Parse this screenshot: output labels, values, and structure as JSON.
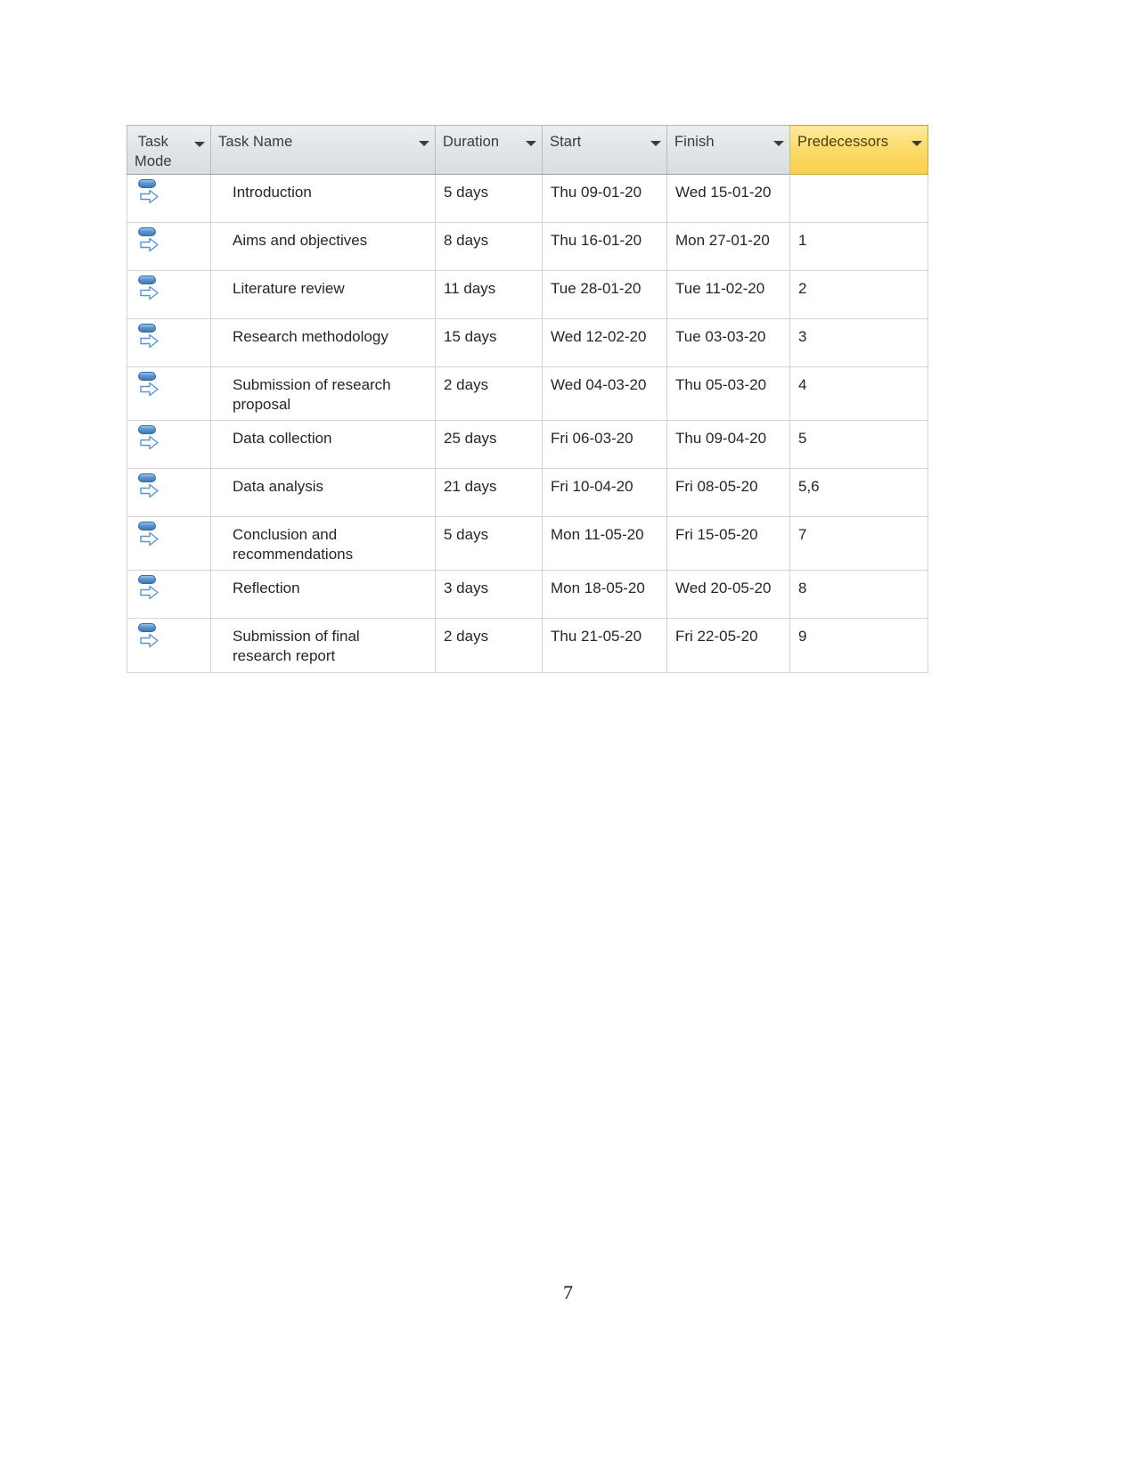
{
  "document": {
    "page_number": "7"
  },
  "table": {
    "columns": [
      {
        "key": "task_mode",
        "label": "Task\nMode",
        "filter_icon": "chevron-down-icon",
        "highlighted": false
      },
      {
        "key": "task_name",
        "label": "Task Name",
        "filter_icon": "chevron-down-icon",
        "highlighted": false
      },
      {
        "key": "duration",
        "label": "Duration",
        "filter_icon": "chevron-down-icon",
        "highlighted": false
      },
      {
        "key": "start",
        "label": "Start",
        "filter_icon": "chevron-down-icon",
        "highlighted": false
      },
      {
        "key": "finish",
        "label": "Finish",
        "filter_icon": "chevron-down-icon",
        "highlighted": false
      },
      {
        "key": "predecessors",
        "label": "Predecessors",
        "filter_icon": "chevron-down-icon",
        "highlighted": true
      }
    ],
    "highlight_color": "#fcd964",
    "header_background": "#e2e5e9",
    "grid_line_color": "#cfd4d9",
    "task_mode_icon": "manually-scheduled-task-icon",
    "rows": [
      {
        "task_mode_icon": "manually-scheduled-task-icon",
        "task_name": "Introduction",
        "duration": "5 days",
        "start": "Thu 09-01-20",
        "finish": "Wed 15-01-20",
        "predecessors": ""
      },
      {
        "task_mode_icon": "manually-scheduled-task-icon",
        "task_name": "Aims and objectives",
        "duration": "8 days",
        "start": "Thu 16-01-20",
        "finish": "Mon 27-01-20",
        "predecessors": "1"
      },
      {
        "task_mode_icon": "manually-scheduled-task-icon",
        "task_name": "Literature review",
        "duration": "11 days",
        "start": "Tue 28-01-20",
        "finish": "Tue 11-02-20",
        "predecessors": "2"
      },
      {
        "task_mode_icon": "manually-scheduled-task-icon",
        "task_name": "Research methodology",
        "duration": "15 days",
        "start": "Wed 12-02-20",
        "finish": "Tue 03-03-20",
        "predecessors": "3"
      },
      {
        "task_mode_icon": "manually-scheduled-task-icon",
        "task_name": "Submission of research\nproposal",
        "duration": "2 days",
        "start": "Wed 04-03-20",
        "finish": "Thu 05-03-20",
        "predecessors": "4"
      },
      {
        "task_mode_icon": "manually-scheduled-task-icon",
        "task_name": "Data collection",
        "duration": "25 days",
        "start": "Fri 06-03-20",
        "finish": "Thu 09-04-20",
        "predecessors": "5"
      },
      {
        "task_mode_icon": "manually-scheduled-task-icon",
        "task_name": "Data analysis",
        "duration": "21 days",
        "start": "Fri 10-04-20",
        "finish": "Fri 08-05-20",
        "predecessors": "5,6"
      },
      {
        "task_mode_icon": "manually-scheduled-task-icon",
        "task_name": "Conclusion and\nrecommendations",
        "duration": "5 days",
        "start": "Mon 11-05-20",
        "finish": "Fri 15-05-20",
        "predecessors": "7"
      },
      {
        "task_mode_icon": "manually-scheduled-task-icon",
        "task_name": "Reflection",
        "duration": "3 days",
        "start": "Mon 18-05-20",
        "finish": "Wed 20-05-20",
        "predecessors": "8"
      },
      {
        "task_mode_icon": "manually-scheduled-task-icon",
        "task_name": "Submission of final\nresearch report",
        "duration": "2 days",
        "start": "Thu 21-05-20",
        "finish": "Fri 22-05-20",
        "predecessors": "9"
      }
    ]
  }
}
